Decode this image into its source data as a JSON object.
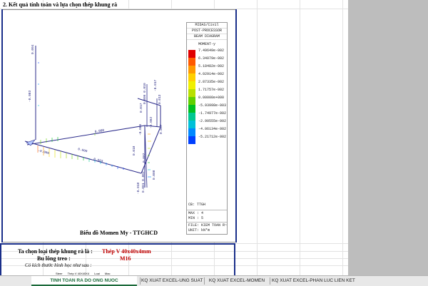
{
  "section_title": "2. Kết quả tính toán và lựa chọn thép khung rà",
  "caption": "Biểu đồ Momen My - TTGHCD",
  "legend": {
    "header": [
      "MIDAS/Civil",
      "POST-PROCESSOR",
      "BEAM DIAGRAM"
    ],
    "title": "MOMENT-y",
    "values": [
      "7.49649e-002",
      "6.34079e-002",
      "5.18482e-002",
      "4.02914e-002",
      "2.87335e-002",
      "1.71757e-002",
      "0.00000e+000",
      "-5.93998e-003",
      "-1.74977e-002",
      "-2.90555e-002",
      "-4.06134e-002",
      "-5.21712e-002"
    ],
    "colors": [
      "#e00000",
      "#ff5a00",
      "#ff9a00",
      "#ffd000",
      "#f0f000",
      "#b8e000",
      "#60d000",
      "#00c020",
      "#00c890",
      "#00c0d8",
      "#0088ff",
      "#0040ff"
    ],
    "cb": "CB: TTGH",
    "max": "MAX : 4",
    "min": "MIN : 5",
    "file": "FILE: KIEM TOAN R~",
    "unit": "UNIT: kN*m"
  },
  "form": {
    "steel_label": "Ta chọn loại thép khung rà là :",
    "steel_value": "Thép V 40x40x4mm",
    "bolt_label": "Bu lông treo :",
    "bolt_value": "M16",
    "dims_label": "Có kích thước hình học như sau :",
    "mini": [
      "Steer",
      "Thép V 40X40X4",
      "Loại",
      "Mac"
    ]
  },
  "diagram_labels": [
    "0.004",
    "-0.003",
    "0.000",
    "0.017",
    "0.006 0.010",
    "-0.017",
    "-0.002",
    "0.007",
    "0.000",
    "0.003",
    "-0.000",
    "-0.006",
    "0.018",
    "0.002",
    "-0.018",
    "0.008",
    "0.001 0.002",
    "0.013"
  ],
  "tabs": [
    {
      "label": "TINH TOAN RA DO ONG NUOC",
      "active": true
    },
    {
      "label": "KQ XUAT EXCEL-UNG SUAT",
      "active": false
    },
    {
      "label": "KQ XUAT EXCEL-MOMEN",
      "active": false
    },
    {
      "label": "KQ XUAT EXCEL-PHAN LUC LIEN KET",
      "active": false
    }
  ]
}
